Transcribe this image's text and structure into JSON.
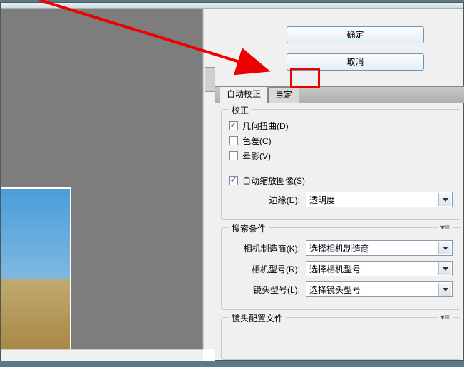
{
  "buttons": {
    "ok": "确定",
    "cancel": "取消"
  },
  "tabs": {
    "auto": "自动校正",
    "custom": "自定"
  },
  "group_correction": {
    "title": "校正",
    "geometric": "几何扭曲(D)",
    "chromatic": "色差(C)",
    "vignette": "晕影(V)",
    "autoscale": "自动缩放图像(S)",
    "edge_label": "边缘(E):",
    "edge_value": "透明度"
  },
  "group_search": {
    "title": "搜索条件",
    "maker_label": "相机制造商(K):",
    "maker_value": "选择相机制造商",
    "model_label": "相机型号(R):",
    "model_value": "选择相机型号",
    "lens_label": "镜头型号(L):",
    "lens_value": "选择镜头型号"
  },
  "group_profile": {
    "title": "镜头配置文件"
  },
  "checked": {
    "geometric": true,
    "chromatic": false,
    "vignette": false,
    "autoscale": true
  }
}
